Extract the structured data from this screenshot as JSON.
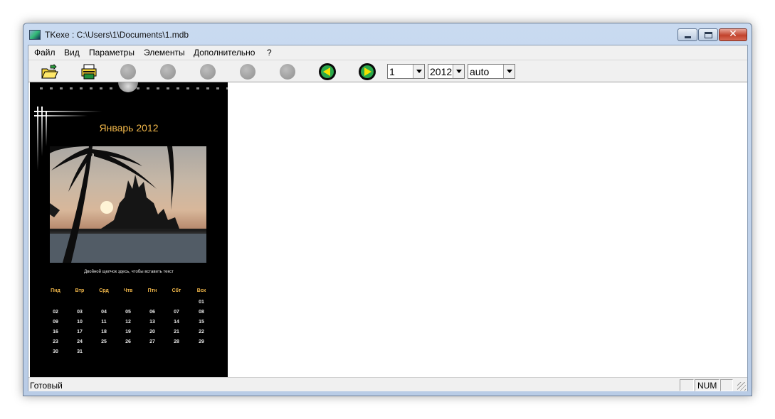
{
  "window": {
    "title": "TKexe : C:\\Users\\1\\Documents\\1.mdb",
    "app_icon": "calendar-app-icon",
    "controls": {
      "minimize": "minimize-icon",
      "maximize": "maximize-icon",
      "close_glyph": "✕"
    }
  },
  "menu": [
    "Файл",
    "Вид",
    "Параметры",
    "Элементы",
    "Дополнительно",
    "?"
  ],
  "toolbar": {
    "icons": [
      "open-folder-icon",
      "print-icon",
      "disabled-icon",
      "disabled-icon",
      "disabled-icon",
      "disabled-icon",
      "disabled-icon",
      "prev-arrow-icon",
      "next-arrow-icon"
    ],
    "month_value": "1",
    "year_value": "2012",
    "layout_value": "auto"
  },
  "calendar": {
    "title": "Январь 2012",
    "caption": "Двойной щелчок здесь, чтобы вставить текст",
    "weekdays": [
      "Пнд",
      "Втр",
      "Срд",
      "Чтв",
      "Птн",
      "Сбт",
      "Вск"
    ],
    "weeks": [
      [
        "",
        "",
        "",
        "",
        "",
        "",
        "01"
      ],
      [
        "02",
        "03",
        "04",
        "05",
        "06",
        "07",
        "08"
      ],
      [
        "09",
        "10",
        "11",
        "12",
        "13",
        "14",
        "15"
      ],
      [
        "16",
        "17",
        "18",
        "19",
        "20",
        "21",
        "22"
      ],
      [
        "23",
        "24",
        "25",
        "26",
        "27",
        "28",
        "29"
      ],
      [
        "30",
        "31",
        "",
        "",
        "",
        "",
        ""
      ]
    ],
    "colors": {
      "title": "#f2b84a",
      "background": "#000000"
    }
  },
  "status": {
    "text": "Готовый",
    "num": "NUM"
  }
}
